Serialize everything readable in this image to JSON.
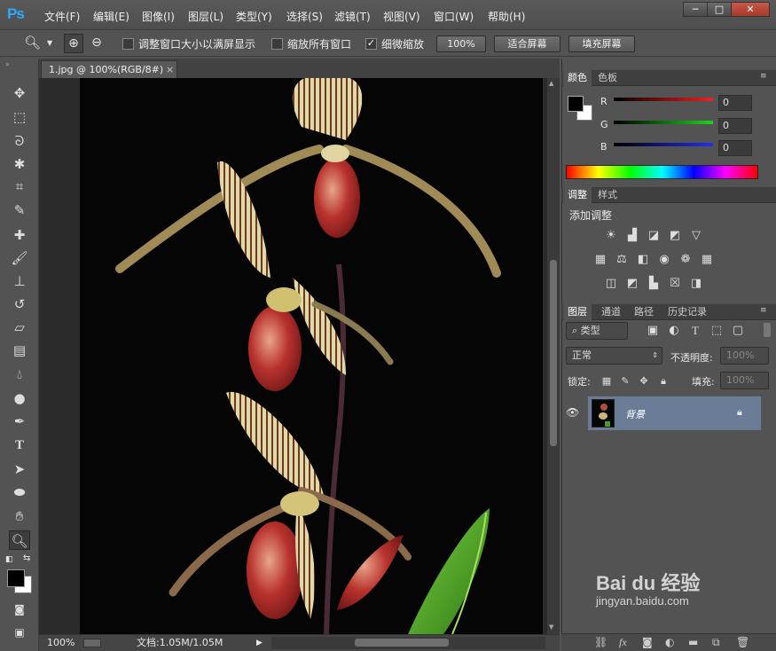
{
  "app": {
    "logo": "Ps"
  },
  "menu": [
    "文件(F)",
    "编辑(E)",
    "图像(I)",
    "图层(L)",
    "类型(Y)",
    "选择(S)",
    "滤镜(T)",
    "视图(V)",
    "窗口(W)",
    "帮助(H)"
  ],
  "window_controls": {
    "minimize": "─",
    "maximize": "□",
    "close": "✕"
  },
  "options": {
    "resize_windows": "调整窗口大小以满屏显示",
    "zoom_all": "缩放所有窗口",
    "scrubby_zoom": "细微缩放",
    "scrubby_checked": true,
    "btn_100": "100%",
    "btn_fit": "适合屏幕",
    "btn_fill": "填充屏幕"
  },
  "document": {
    "tab_title": "1.jpg @ 100%(RGB/8#)",
    "close": "×"
  },
  "status": {
    "zoom": "100%",
    "doc_info": "文档:1.05M/1.05M"
  },
  "color_panel": {
    "tabs": [
      "颜色",
      "色板"
    ],
    "channels": [
      {
        "label": "R",
        "value": "0",
        "color": "#e02020"
      },
      {
        "label": "G",
        "value": "0",
        "color": "#20c020"
      },
      {
        "label": "B",
        "value": "0",
        "color": "#2030e0"
      }
    ]
  },
  "adjust_panel": {
    "tabs": [
      "调整",
      "样式"
    ],
    "title": "添加调整"
  },
  "layers_panel": {
    "tabs": [
      "图层",
      "通道",
      "路径",
      "历史记录"
    ],
    "kind_filter": "类型",
    "blend_mode": "正常",
    "opacity_label": "不透明度:",
    "opacity_value": "100%",
    "lock_label": "锁定:",
    "fill_label": "填充:",
    "fill_value": "100%",
    "layer_name": "背景"
  },
  "watermark": {
    "brand": "Bai du 经验",
    "url": "jingyan.baidu.com"
  }
}
